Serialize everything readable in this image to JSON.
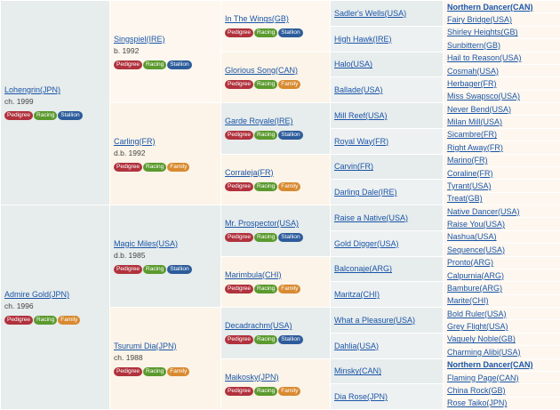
{
  "pedigree": {
    "sire": {
      "name": "Lohengrin(JPN)",
      "info": "ch. 1999",
      "badges": [
        "Pedigree",
        "Racing",
        "Stallion"
      ]
    },
    "sire_sire": {
      "name": "Singspiel(IRE)",
      "info": "b. 1992",
      "badges": [
        "Pedigree",
        "Racing",
        "Stallion"
      ]
    },
    "sire_sire_sire": {
      "name": "In The Wings(GB)",
      "badges": [
        "Pedigree",
        "Racing",
        "Stallion"
      ]
    },
    "sire_sire_dam": {
      "name": "Glorious Song(CAN)",
      "badges": [
        "Pedigree",
        "Racing",
        "Family"
      ]
    },
    "sire_dam": {
      "name": "Carling(FR)",
      "info": "d.b. 1992",
      "badges": [
        "Pedigree",
        "Racing",
        "Family"
      ]
    },
    "sire_dam_sire": {
      "name": "Garde Royale(IRE)",
      "badges": [
        "Pedigree",
        "Racing",
        "Stallion"
      ]
    },
    "sire_dam_dam": {
      "name": "Corraleja(FR)",
      "badges": [
        "Pedigree",
        "Racing",
        "Family"
      ]
    },
    "dam": {
      "name": "Admire Gold(JPN)",
      "info": "ch. 1996",
      "badges": [
        "Pedigree",
        "Racing",
        "Family"
      ]
    },
    "dam_sire": {
      "name": "Magic Miles(USA)",
      "info": "d.b. 1985",
      "badges": [
        "Pedigree",
        "Racing",
        "Stallion"
      ]
    },
    "dam_sire_sire": {
      "name": "Mr. Prospector(USA)",
      "badges": [
        "Pedigree",
        "Racing",
        "Stallion"
      ]
    },
    "dam_sire_dam": {
      "name": "Marimbula(CHI)",
      "badges": [
        "Pedigree",
        "Racing",
        "Family"
      ]
    },
    "dam_dam": {
      "name": "Tsurumi Dia(JPN)",
      "info": "ch. 1988",
      "badges": [
        "Pedigree",
        "Racing",
        "Family"
      ]
    },
    "dam_dam_sire": {
      "name": "Decadrachm(USA)",
      "badges": [
        "Pedigree",
        "Racing",
        "Stallion"
      ]
    },
    "dam_dam_dam": {
      "name": "Maikosky(JPN)",
      "badges": [
        "Pedigree",
        "Racing",
        "Family"
      ]
    },
    "gen4": [
      "Sadler's Wells(USA)",
      "High Hawk(IRE)",
      "Halo(USA)",
      "Ballade(USA)",
      "Mill Reef(USA)",
      "Royal Way(FR)",
      "Carvin(FR)",
      "Darling Dale(IRE)",
      "Raise a Native(USA)",
      "Gold Digger(USA)",
      "Balconaje(ARG)",
      "Maritza(CHI)",
      "What a Pleasure(USA)",
      "Dahlia(USA)",
      "Minsky(CAN)",
      "Dia Rose(JPN)"
    ],
    "gen5": [
      "Northern Dancer(CAN)",
      "Fairy Bridge(USA)",
      "Shirley Heights(GB)",
      "Sunbittern(GB)",
      "Hail to Reason(USA)",
      "Cosmah(USA)",
      "Herbager(FR)",
      "Miss Swapsco(USA)",
      "Never Bend(USA)",
      "Milan Mill(USA)",
      "Sicambre(FR)",
      "Right Away(FR)",
      "Marino(FR)",
      "Coraline(FR)",
      "Tyrant(USA)",
      "Treat(GB)",
      "Native Dancer(USA)",
      "Raise You(USA)",
      "Nashua(USA)",
      "Sequence(USA)",
      "Pronto(ARG)",
      "Calpurnia(ARG)",
      "Bambure(ARG)",
      "Marite(CHI)",
      "Bold Ruler(USA)",
      "Grey Flight(USA)",
      "Vaguely Noble(GB)",
      "Charming Alibi(USA)",
      "Northern Dancer(CAN)",
      "Flaming Page(CAN)",
      "China Rock(GB)",
      "Rose Taiko(JPN)"
    ]
  },
  "colors": {
    "pedigree": "#b0323d",
    "racing": "#5b9a2e",
    "stallion": "#2d5c9b",
    "family": "#d88a30",
    "link": "#1a55a8"
  }
}
